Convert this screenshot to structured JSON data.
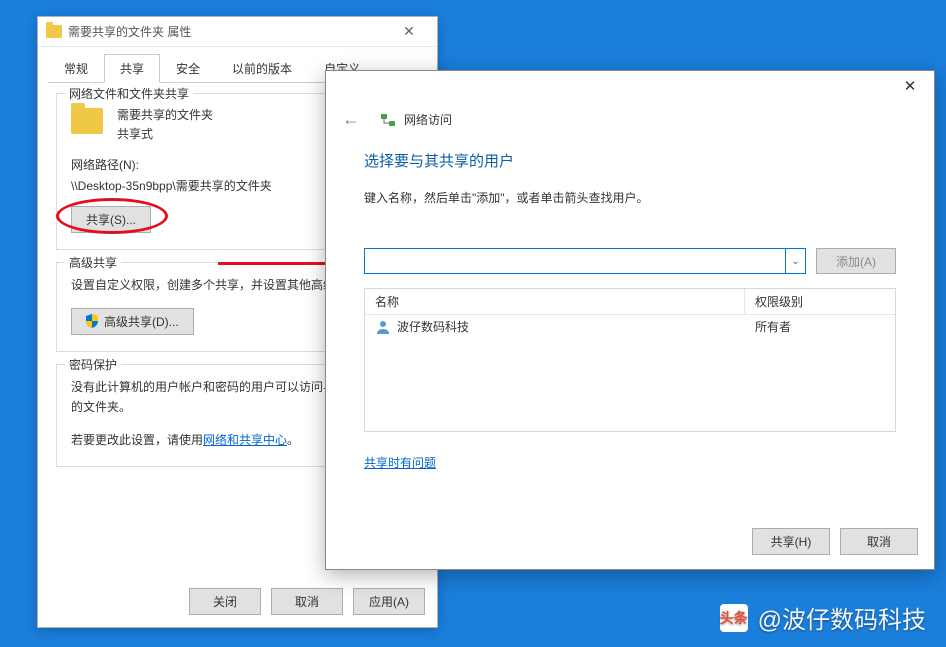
{
  "props": {
    "title": "需要共享的文件夹 属性",
    "tabs": [
      "常规",
      "共享",
      "安全",
      "以前的版本",
      "自定义"
    ],
    "active_tab": 1,
    "group_network": {
      "title": "网络文件和文件夹共享",
      "folder_name": "需要共享的文件夹",
      "share_status": "共享式",
      "path_label": "网络路径(N):",
      "path_value": "\\\\Desktop-35n9bpp\\需要共享的文件夹",
      "share_btn": "共享(S)..."
    },
    "group_advanced": {
      "title": "高级共享",
      "text": "设置自定义权限，创建多个共享，并设置其他高级共享选项。",
      "btn": "高级共享(D)..."
    },
    "group_password": {
      "title": "密码保护",
      "text1": "没有此计算机的用户帐户和密码的用户可以访问与所有人共享的文件夹。",
      "text2_prefix": "若要更改此设置，请使用",
      "text2_link": "网络和共享中心",
      "text2_suffix": "。"
    },
    "footer": {
      "close": "关闭",
      "cancel": "取消",
      "apply": "应用(A)"
    }
  },
  "net": {
    "breadcrumb": "网络访问",
    "instruction": "选择要与其共享的用户",
    "subtext": "键入名称，然后单击\"添加\"，或者单击箭头查找用户。",
    "add_btn": "添加(A)",
    "col_name": "名称",
    "col_perm": "权限级别",
    "rows": [
      {
        "name": "波仔数码科技",
        "perm": "所有者"
      }
    ],
    "trouble_link": "共享时有问题",
    "footer": {
      "share": "共享(H)",
      "cancel": "取消"
    }
  },
  "watermark": {
    "label": "头条",
    "text": "@波仔数码科技"
  }
}
